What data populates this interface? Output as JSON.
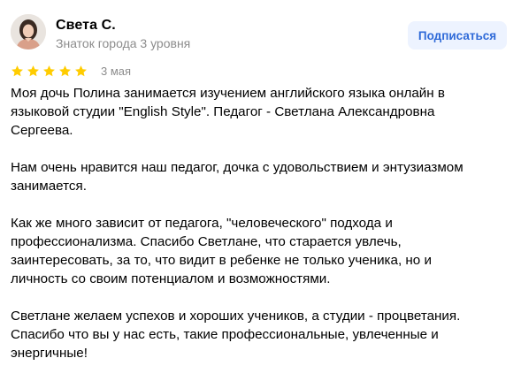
{
  "author": {
    "name": "Света С.",
    "level": "Знаток города 3 уровня",
    "avatar_icon": "user-avatar-photo"
  },
  "subscribe_label": "Подписаться",
  "rating": {
    "value": 5,
    "max": 5,
    "star_color": "#fc0",
    "date": "3 мая"
  },
  "review": {
    "paragraphs": [
      "Моя дочь Полина занимается изучением английского языка онлайн в\nязыковой студии \"English Style\". Педагог - Светлана Александровна\nСергеева.",
      "Нам очень нравится наш педагог, дочка с удовольствием и энтузиазмом\nзанимается.",
      "Как же много зависит от педагога, \"человеческого\" подхода и\nпрофессионализма. Спасибо Светлане, что старается увлечь,\nзаинтересовать, за то, что видит в ребенке не только ученика, но и\nличность со своим потенциалом и возможностями.",
      "Светлане желаем успехов и хороших учеников, а студии - процветания.\nСпасибо что вы у нас есть, такие профессиональные, увлеченные и\nэнергичные!"
    ]
  },
  "colors": {
    "accent": "#2f6ad8",
    "button_bg": "#edf3ff",
    "muted_text": "#8c8c8c"
  }
}
